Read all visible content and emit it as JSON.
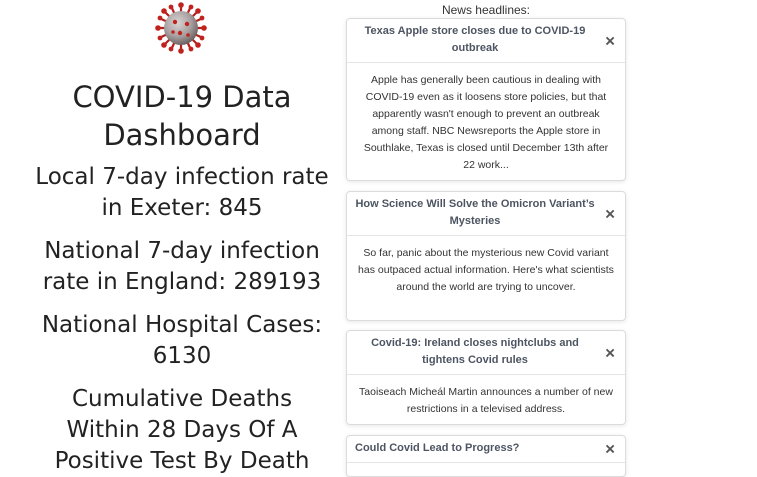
{
  "logo": {
    "icon": "coronavirus-icon"
  },
  "stats": {
    "title": "COVID-19 Data Dashboard",
    "local_infection": "Local 7-day infection rate in Exeter: 845",
    "national_infection": "National 7-day infection rate in England: 289193",
    "hospital_cases": "National Hospital Cases: 6130",
    "cumulative_deaths": "Cumulative Deaths Within 28 Days Of A Positive Test By Death"
  },
  "news": {
    "heading": "News headlines:",
    "close_symbol": "×",
    "articles": [
      {
        "title": "Texas Apple store closes due to COVID-19 outbreak",
        "body": "Apple has generally been cautious in dealing with COVID-19 even as it loosens store policies, but that apparently wasn't enough to prevent an outbreak among staff. NBC Newsreports the Apple store in Southlake, Texas is closed until December 13th after 22 work..."
      },
      {
        "title": "How Science Will Solve the Omicron Variant’s Mysteries",
        "body": "So far, panic about the mysterious new Covid variant has outpaced actual information. Here's what scientists around the world are trying to uncover."
      },
      {
        "title": "Covid-19: Ireland closes nightclubs and tightens Covid rules",
        "body": "Taoiseach Micheál Martin announces a number of new restrictions in a televised address."
      },
      {
        "title": "Could Covid Lead to Progress?",
        "body": ""
      }
    ]
  }
}
